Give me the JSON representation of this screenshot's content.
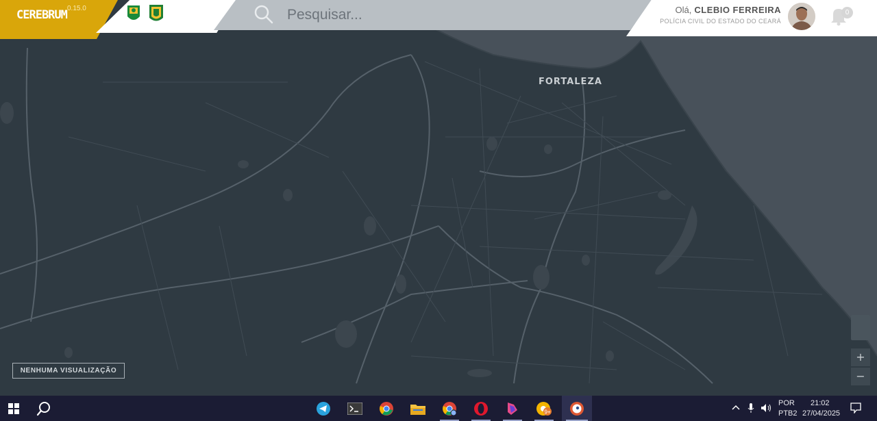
{
  "app": {
    "name": "CEREBRUM",
    "version": "0.15.0"
  },
  "search": {
    "placeholder": "Pesquisar..."
  },
  "user": {
    "greeting": "Olá,",
    "name": "CLEBIO FERREIRA",
    "organization": "POLÍCIA CIVIL DO ESTADO DO CEARÁ",
    "notifications": "0"
  },
  "map": {
    "city_label": "FORTALEZA",
    "visualization_button": "NENHUMA VISUALIZAÇÃO",
    "zoom_in": "+",
    "zoom_out": "−"
  },
  "taskbar": {
    "apps": [
      "windows-start",
      "search",
      "telegram",
      "terminal",
      "chrome",
      "file-explorer",
      "chrome-profile",
      "opera",
      "app-launcher",
      "chrome-badge",
      "duckduckgo"
    ],
    "tray": {
      "lang_top": "POR",
      "lang_bottom": "PTB2",
      "time": "21:02",
      "date": "27/04/2025"
    }
  },
  "colors": {
    "brand": "#d9a60a",
    "map_land": "#2f3a42",
    "map_sea": "#49525a",
    "taskbar": "#1b1c34"
  }
}
